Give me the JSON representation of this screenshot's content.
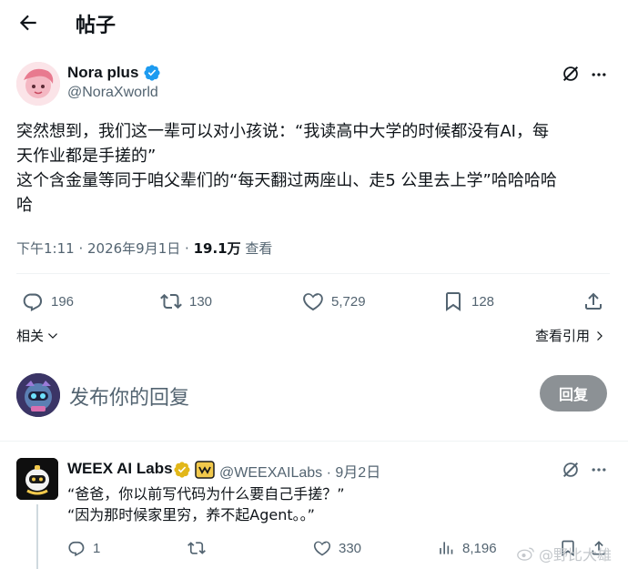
{
  "header": {
    "title": "帖子"
  },
  "post": {
    "author_name": "Nora plus",
    "handle": "@NoraXworld",
    "text_lines": [
      "突然想到，我们这一辈可以对小孩说：“我读高中大学的时候都没有AI，每",
      "天作业都是手搓的”",
      "这个含金量等同于咱父辈们的“每天翻过两座山、走5 公里去上学”哈哈哈哈",
      "哈"
    ],
    "time": "下午1:11",
    "date": "2026年9月1日",
    "views_count": "19.1万",
    "views_label": "查看",
    "replies": "196",
    "reposts": "130",
    "likes": "5,729",
    "bookmarks": "128"
  },
  "related_label": "相关",
  "view_quotes_label": "查看引用",
  "compose": {
    "placeholder": "发布你的回复",
    "button": "回复"
  },
  "reply": {
    "author_name": "WEEX AI Labs",
    "handle": "@WEEXAILabs",
    "date": "9月2日",
    "line1": "“爸爸，你以前写代码为什么要自己手搓？”",
    "line2": "“因为那时候家里穷，养不起Agent。。”",
    "replies": "1",
    "likes": "330",
    "views": "8,196"
  },
  "watermark": "@野比大雄",
  "colors": {
    "verified_blue": "#1d9bf0",
    "verified_gold": "#e2b719",
    "text_primary": "#0f1419",
    "text_secondary": "#536471",
    "reply_button_bg": "#8c9195"
  },
  "icons": [
    "back-arrow-icon",
    "verified-badge-icon",
    "grok-icon",
    "more-icon",
    "reply-icon",
    "repost-icon",
    "like-icon",
    "bookmark-icon",
    "share-icon",
    "chevron-down-icon",
    "chevron-right-icon",
    "gold-verified-icon",
    "affiliate-badge-icon",
    "views-icon",
    "weibo-icon"
  ]
}
